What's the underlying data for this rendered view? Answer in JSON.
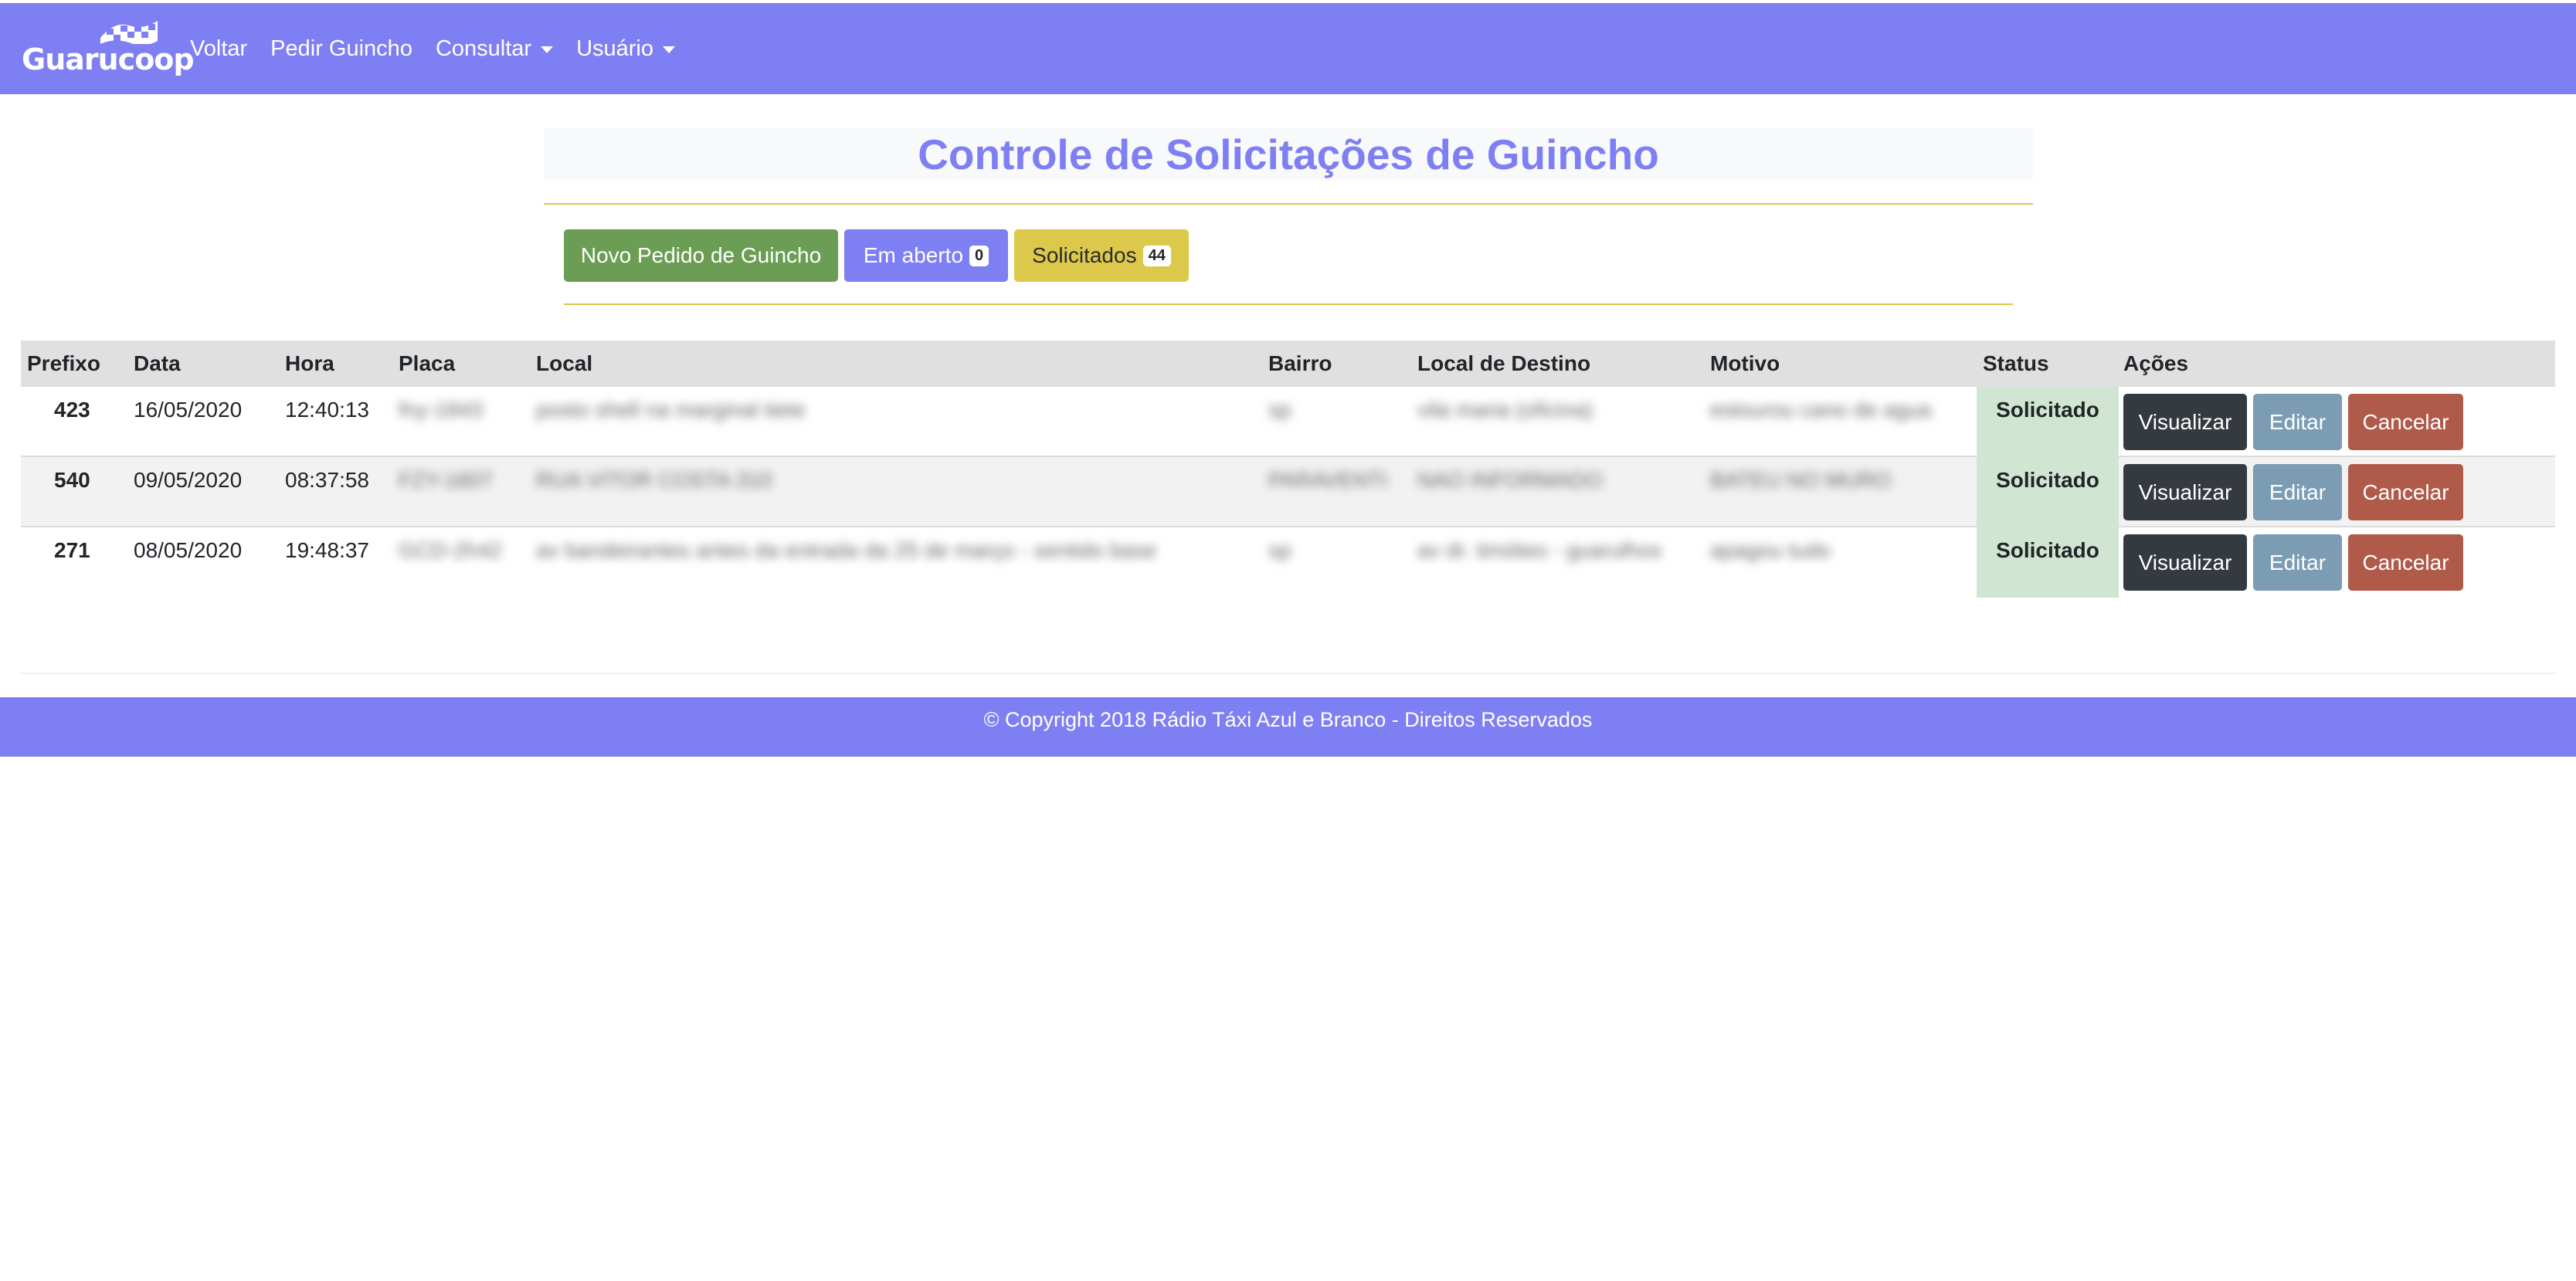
{
  "navbar": {
    "brand": "Guarucoop",
    "links": {
      "voltar": "Voltar",
      "pedir_guincho": "Pedir Guincho",
      "consultar": "Consultar",
      "usuario": "Usuário"
    }
  },
  "header": {
    "title": "Controle de Solicitações de Guincho"
  },
  "buttons": {
    "novo_pedido": "Novo Pedido de Guincho",
    "em_aberto": "Em aberto",
    "em_aberto_count": "0",
    "solicitados": "Solicitados",
    "solicitados_count": "44"
  },
  "table": {
    "columns": [
      "Prefixo",
      "Data",
      "Hora",
      "Placa",
      "Local",
      "Bairro",
      "Local de Destino",
      "Motivo",
      "Status",
      "Ações"
    ],
    "rows": [
      {
        "prefixo": "423",
        "data": "16/05/2020",
        "hora": "12:40:13",
        "placa": "fny-1843",
        "local": "posto shell na marginal tiete",
        "bairro": "sp",
        "destino": "vila maria (oficina)",
        "motivo": "estourou cano de agua",
        "status": "Solicitado"
      },
      {
        "prefixo": "540",
        "data": "09/05/2020",
        "hora": "08:37:58",
        "placa": "FZY-1607",
        "local": "RUA VITOR COSTA 310",
        "bairro": "PARAVENTI",
        "destino": "NAO INFORMADO",
        "motivo": "BATEU NO MURO",
        "status": "Solicitado"
      },
      {
        "prefixo": "271",
        "data": "08/05/2020",
        "hora": "19:48:37",
        "placa": "GCD-2h42",
        "local": "av bandeirantes antes da entrada da 25 de março - sentido base",
        "bairro": "sp",
        "destino": "av dr. timóteo - guarulhos",
        "motivo": "apagou tudo",
        "status": "Solicitado"
      }
    ],
    "actions": {
      "view": "Visualizar",
      "edit": "Editar",
      "cancel": "Cancelar"
    }
  },
  "footer": {
    "text": "© Copyright 2018 Rádio Táxi Azul e Branco - Direitos Reservados"
  },
  "colors": {
    "primary": "#7f7ff4",
    "success": "#6b9e54",
    "warning": "#dcc94c",
    "dark": "#343a40",
    "info": "#7c9cb4",
    "danger": "#b05a4a",
    "status_bg": "#d1e6d2"
  }
}
